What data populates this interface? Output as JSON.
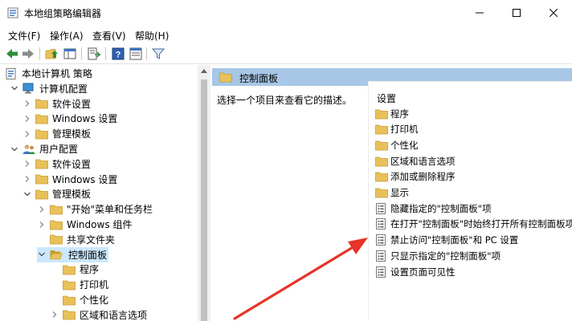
{
  "window": {
    "title": "本地组策略编辑器"
  },
  "menu": [
    {
      "label": "文件(F)"
    },
    {
      "label": "操作(A)"
    },
    {
      "label": "查看(V)"
    },
    {
      "label": "帮助(H)"
    }
  ],
  "toolbar": {
    "icons": [
      "back-arrow-icon",
      "forward-arrow-icon",
      "up-folder-icon",
      "show-hide-tree-icon",
      "export-list-icon",
      "help-icon",
      "properties-icon",
      "filter-icon"
    ]
  },
  "tree": [
    {
      "label": "本地计算机 策略",
      "icon": "policy-icon",
      "indent": 0,
      "twisty": ""
    },
    {
      "label": "计算机配置",
      "icon": "computer-icon",
      "indent": 1,
      "twisty": "open"
    },
    {
      "label": "软件设置",
      "icon": "folder-icon",
      "indent": 2,
      "twisty": "closed"
    },
    {
      "label": "Windows 设置",
      "icon": "folder-icon",
      "indent": 2,
      "twisty": "closed"
    },
    {
      "label": "管理模板",
      "icon": "folder-icon",
      "indent": 2,
      "twisty": "closed"
    },
    {
      "label": "用户配置",
      "icon": "user-icon",
      "indent": 1,
      "twisty": "open"
    },
    {
      "label": "软件设置",
      "icon": "folder-icon",
      "indent": 2,
      "twisty": "closed"
    },
    {
      "label": "Windows 设置",
      "icon": "folder-icon",
      "indent": 2,
      "twisty": "closed"
    },
    {
      "label": "管理模板",
      "icon": "folder-icon",
      "indent": 2,
      "twisty": "open"
    },
    {
      "label": "\"开始\"菜单和任务栏",
      "icon": "folder-icon",
      "indent": 3,
      "twisty": "closed"
    },
    {
      "label": "Windows 组件",
      "icon": "folder-icon",
      "indent": 3,
      "twisty": "closed"
    },
    {
      "label": "共享文件夹",
      "icon": "folder-icon",
      "indent": 3,
      "twisty": ""
    },
    {
      "label": "控制面板",
      "icon": "folder-open-icon",
      "indent": 3,
      "twisty": "open",
      "selected": true
    },
    {
      "label": "程序",
      "icon": "folder-icon",
      "indent": 4,
      "twisty": ""
    },
    {
      "label": "打印机",
      "icon": "folder-icon",
      "indent": 4,
      "twisty": ""
    },
    {
      "label": "个性化",
      "icon": "folder-icon",
      "indent": 4,
      "twisty": ""
    },
    {
      "label": "区域和语言选项",
      "icon": "folder-icon",
      "indent": 4,
      "twisty": "closed"
    }
  ],
  "right": {
    "header": "控制面板",
    "description": "选择一个项目来查看它的描述。",
    "column_header": "设置",
    "items": [
      {
        "label": "程序",
        "icon": "folder-icon"
      },
      {
        "label": "打印机",
        "icon": "folder-icon"
      },
      {
        "label": "个性化",
        "icon": "folder-icon"
      },
      {
        "label": "区域和语言选项",
        "icon": "folder-icon"
      },
      {
        "label": "添加或删除程序",
        "icon": "folder-icon"
      },
      {
        "label": "显示",
        "icon": "folder-icon"
      },
      {
        "label": "隐藏指定的\"控制面板\"项",
        "icon": "setting-icon"
      },
      {
        "label": "在打开\"控制面板\"时始终打开所有控制面板项",
        "icon": "setting-icon"
      },
      {
        "label": "禁止访问\"控制面板\"和 PC 设置",
        "icon": "setting-icon"
      },
      {
        "label": "只显示指定的\"控制面板\"项",
        "icon": "setting-icon"
      },
      {
        "label": "设置页面可见性",
        "icon": "setting-icon"
      }
    ]
  },
  "colors": {
    "folder": "#e8c15a",
    "folder_dark": "#c99a2e",
    "header_bar": "#a8c6e6",
    "selected": "#cce8ff",
    "arrow": "#e8332a"
  }
}
